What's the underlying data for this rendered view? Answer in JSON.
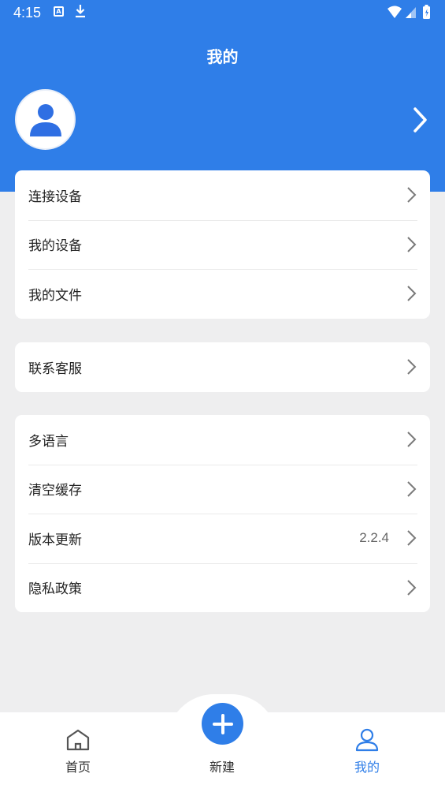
{
  "status_bar": {
    "time": "4:15",
    "a_badge": "A"
  },
  "header": {
    "title": "我的"
  },
  "group1": [
    {
      "label": "连接设备"
    },
    {
      "label": "我的设备"
    },
    {
      "label": "我的文件"
    }
  ],
  "group2": [
    {
      "label": "联系客服"
    }
  ],
  "group3": [
    {
      "label": "多语言"
    },
    {
      "label": "清空缓存"
    },
    {
      "label": "版本更新",
      "value": "2.2.4"
    },
    {
      "label": "隐私政策"
    }
  ],
  "tabbar": {
    "home_label": "首页",
    "new_label": "新建",
    "mine_label": "我的"
  },
  "colors": {
    "accent": "#2f7ee8",
    "background": "#eeeeef"
  }
}
